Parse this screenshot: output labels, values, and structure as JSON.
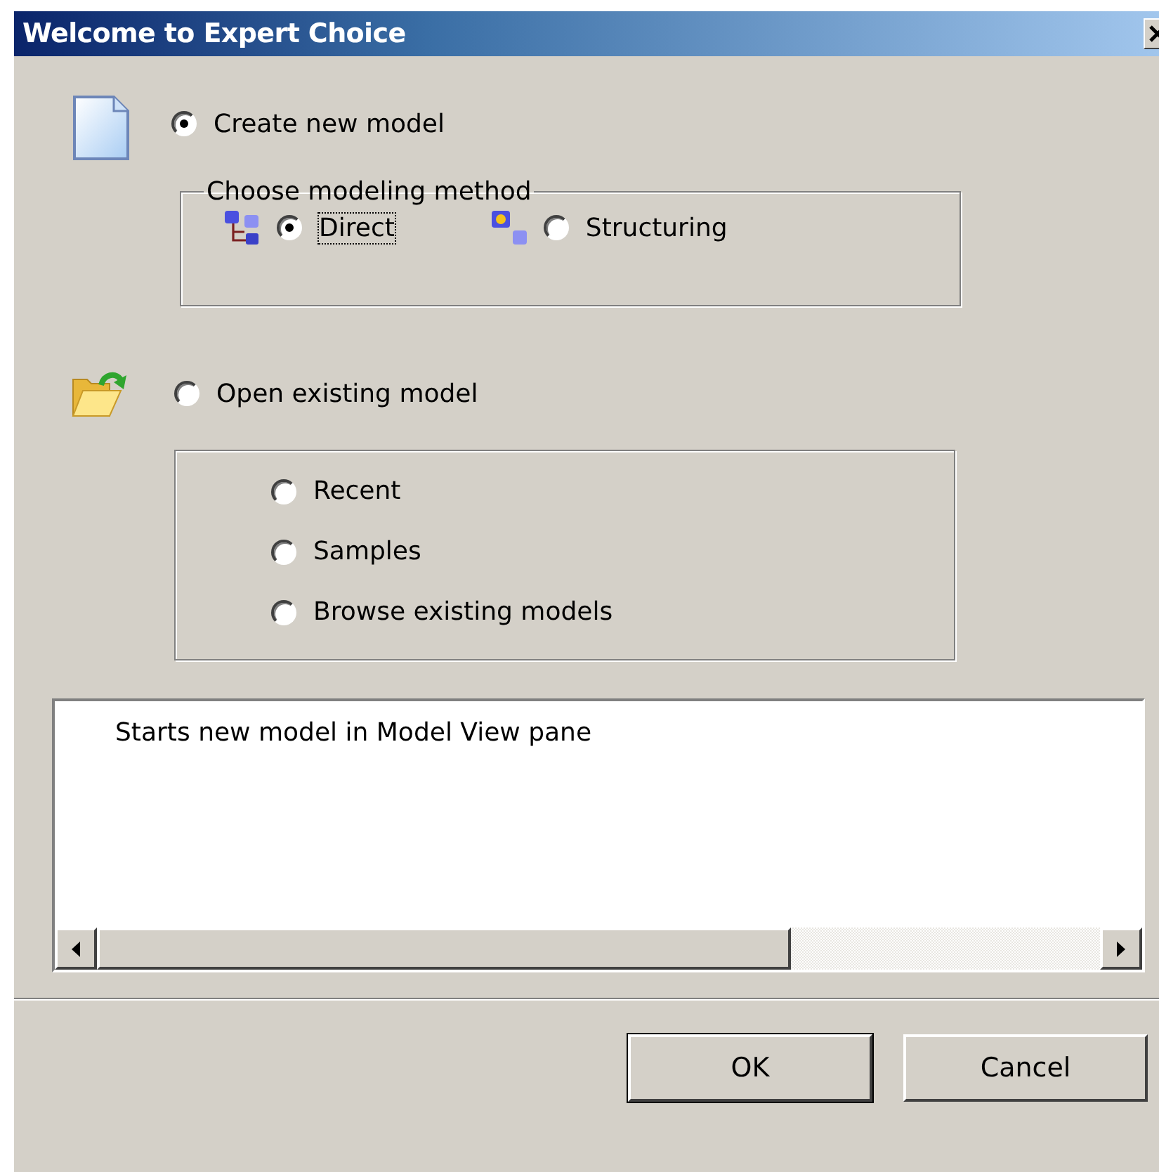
{
  "window": {
    "title": "Welcome to Expert Choice"
  },
  "create": {
    "label": "Create new model",
    "selected": true
  },
  "method_group": {
    "legend": "Choose modeling method",
    "methods": [
      {
        "label": "Direct",
        "selected": true,
        "focused": true,
        "kind": "tree"
      },
      {
        "label": "Structuring",
        "selected": false,
        "focused": false,
        "kind": "nodes"
      }
    ]
  },
  "open": {
    "label": "Open existing model",
    "selected": false
  },
  "sources": [
    {
      "label": "Recent",
      "selected": false
    },
    {
      "label": "Samples",
      "selected": false
    },
    {
      "label": "Browse existing models",
      "selected": false
    }
  ],
  "description": {
    "text": "Starts new model in Model View pane"
  },
  "buttons": [
    {
      "label": "OK",
      "default": true
    },
    {
      "label": "Cancel",
      "default": false
    }
  ]
}
